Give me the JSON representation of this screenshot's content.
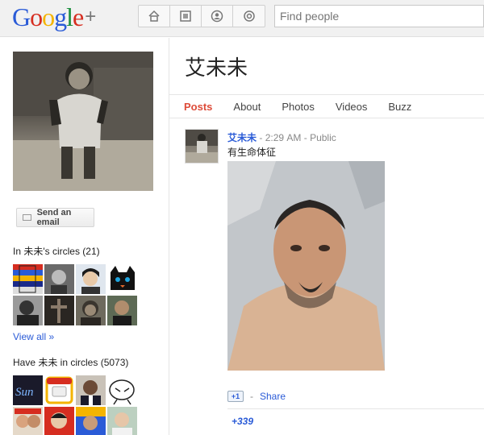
{
  "header": {
    "logo_letters": [
      "G",
      "o",
      "o",
      "g",
      "l",
      "e"
    ],
    "logo_plus": "+",
    "nav_icons": [
      "home-icon",
      "photos-icon",
      "profile-icon",
      "circles-icon"
    ],
    "search_placeholder": "Find people"
  },
  "profile": {
    "name": "艾未未",
    "send_email_label": "Send an email",
    "in_circles_label": "In 未未's circles (21)",
    "view_all_label": "View all »",
    "have_in_circles_label": "Have 未未 in circles (5073)"
  },
  "tabs": [
    "Posts",
    "About",
    "Photos",
    "Videos",
    "Buzz"
  ],
  "active_tab": "Posts",
  "post": {
    "author": "艾未未",
    "separator": " - ",
    "time": "2:29 AM",
    "visibility": "Public",
    "text": "有生命体征",
    "plus_one_label": "+1",
    "share_label": "Share",
    "plus_count": "+339"
  },
  "colors": {
    "accent_red": "#dd4b39",
    "link_blue": "#2a5bd7"
  }
}
